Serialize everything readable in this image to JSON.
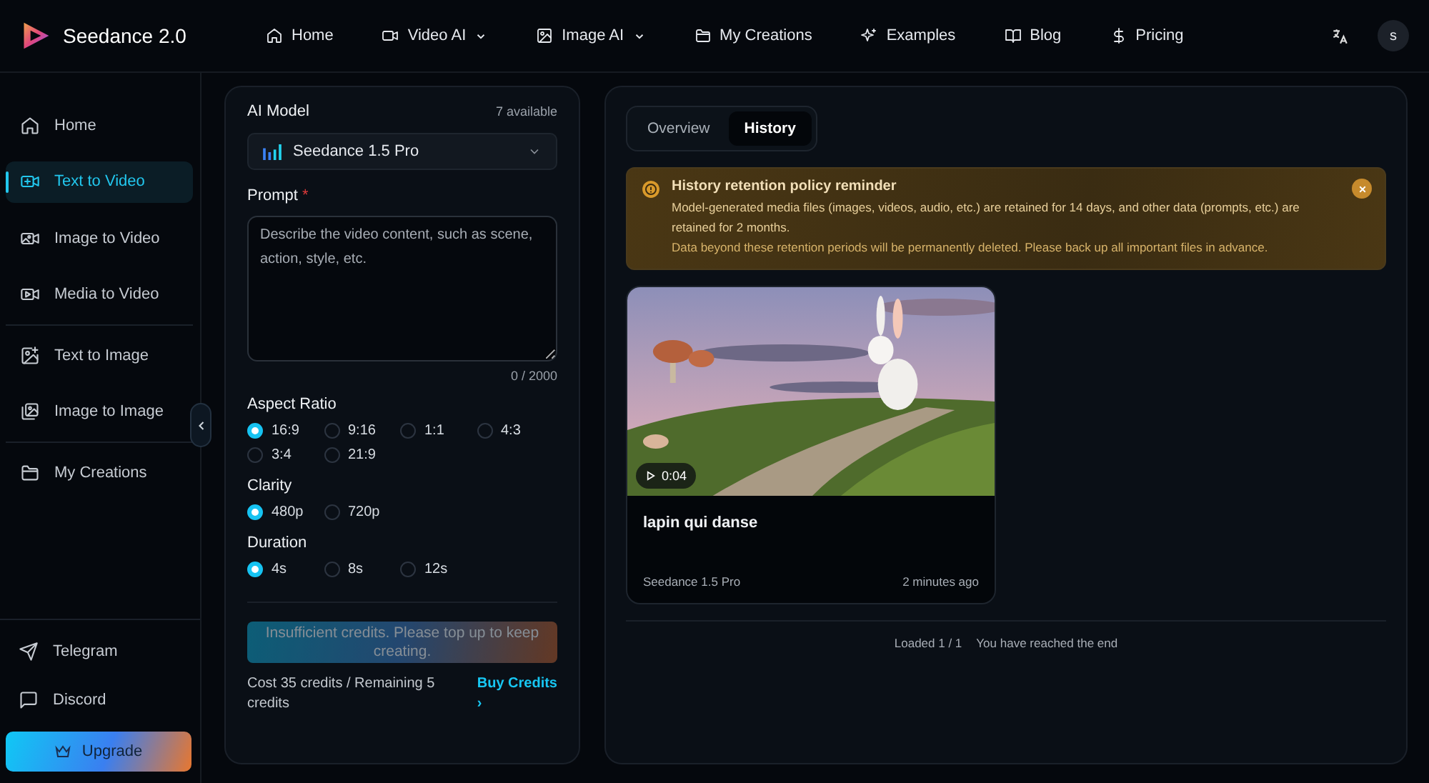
{
  "header": {
    "brand": "Seedance 2.0",
    "nav": [
      {
        "label": "Home",
        "dropdown": false
      },
      {
        "label": "Video AI",
        "dropdown": true
      },
      {
        "label": "Image AI",
        "dropdown": true
      },
      {
        "label": "My Creations",
        "dropdown": false
      },
      {
        "label": "Examples",
        "dropdown": false
      },
      {
        "label": "Blog",
        "dropdown": false
      },
      {
        "label": "Pricing",
        "dropdown": false
      }
    ],
    "avatar": "s"
  },
  "sidebar": {
    "groups": [
      [
        {
          "label": "Home",
          "selected": false
        },
        {
          "label": "Text to Video",
          "selected": true
        },
        {
          "label": "Image to Video",
          "selected": false
        },
        {
          "label": "Media to Video",
          "selected": false
        }
      ],
      [
        {
          "label": "Text to Image",
          "selected": false
        },
        {
          "label": "Image to Image",
          "selected": false
        }
      ],
      [
        {
          "label": "My Creations",
          "selected": false
        }
      ]
    ],
    "links": [
      {
        "label": "Telegram"
      },
      {
        "label": "Discord"
      }
    ],
    "upgrade": "Upgrade"
  },
  "form": {
    "model_label": "AI Model",
    "model_count": "7 available",
    "model": "Seedance 1.5 Pro",
    "prompt_label": "Prompt",
    "required_mark": "*",
    "prompt_placeholder": "Describe the video content, such as scene, action, style, etc.",
    "prompt_count": "0 / 2000",
    "options": [
      {
        "label": "Aspect Ratio",
        "choices": [
          {
            "label": "16:9",
            "selected": true
          },
          {
            "label": "9:16",
            "selected": false
          },
          {
            "label": "1:1",
            "selected": false
          },
          {
            "label": "4:3",
            "selected": false
          },
          {
            "label": "3:4",
            "selected": false
          },
          {
            "label": "21:9",
            "selected": false
          }
        ]
      },
      {
        "label": "Clarity",
        "choices": [
          {
            "label": "480p",
            "selected": true
          },
          {
            "label": "720p",
            "selected": false
          }
        ]
      },
      {
        "label": "Duration",
        "choices": [
          {
            "label": "4s",
            "selected": true
          },
          {
            "label": "8s",
            "selected": false
          },
          {
            "label": "12s",
            "selected": false
          }
        ]
      }
    ],
    "submit": {
      "label": "Insufficient credits. Please top up to keep creating.",
      "disabled": true
    },
    "cost": "Cost 35 credits / Remaining 5 credits",
    "buy": "Buy Credits",
    "buy_arrow": "›"
  },
  "history": {
    "tabs": [
      {
        "label": "Overview",
        "selected": false
      },
      {
        "label": "History",
        "selected": true
      }
    ],
    "notice": {
      "title": "History retention policy reminder",
      "lines": [
        "Model-generated media files (images, videos, audio, etc.) are retained for 14 days, and other data (prompts, etc.) are retained for 2 months.",
        "Data beyond these retention periods will be permanently deleted. Please back up all important files in advance."
      ]
    },
    "cards": [
      {
        "kind": "picture",
        "duration": "0:04",
        "title": "lapin qui danse",
        "model": "Seedance 1.5 Pro",
        "time": "2 minutes ago"
      }
    ],
    "footer": [
      "Loaded 1 / 1",
      "You have reached the end"
    ]
  }
}
